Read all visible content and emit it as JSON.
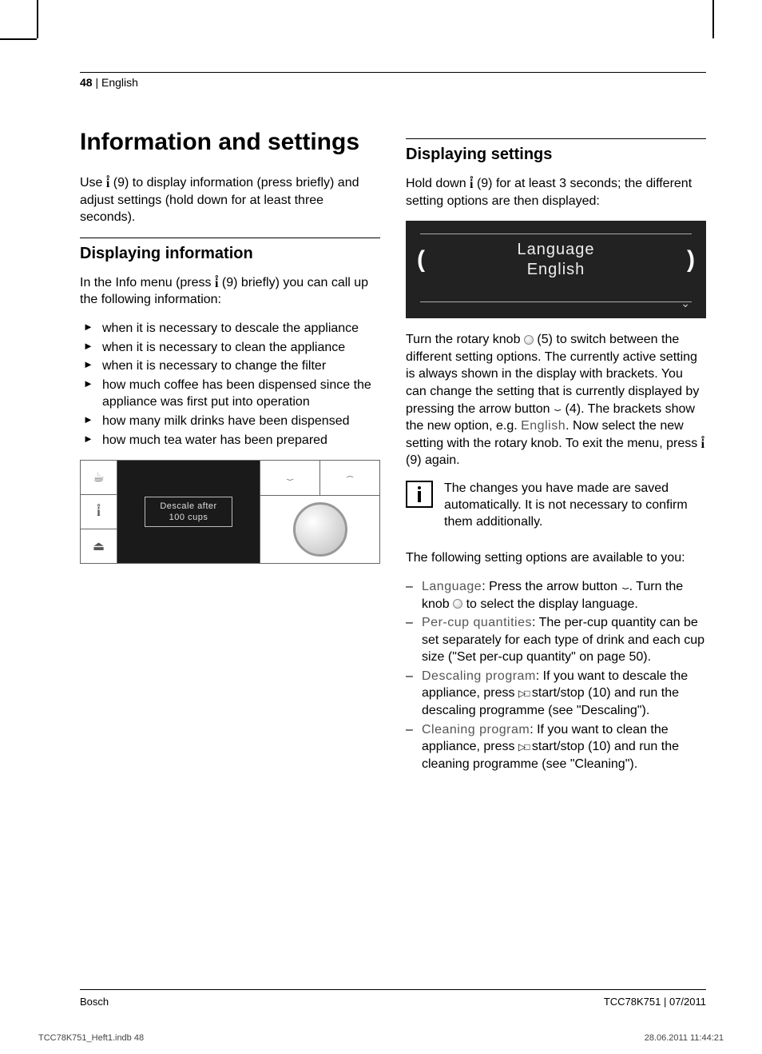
{
  "header": {
    "page_num": "48",
    "lang": "English"
  },
  "col1": {
    "h1": "Information and settings",
    "p1a": "Use ",
    "p1b": " (9) to display information (press briefly) and adjust settings (hold down for at least three seconds).",
    "h2": "Displaying information",
    "p2a": "In the Info menu (press ",
    "p2b": " (9) briefly) you can call up the following information:",
    "bullets": [
      "when it is necessary to descale the appliance",
      "when it is necessary to clean the appliance",
      "when it is necessary to change the filter",
      "how much coffee has been dispensed since the appliance was first put into operation",
      "how many milk drinks have been dispensed",
      "how much tea water has been prepared"
    ],
    "panel": {
      "l1": "Descale after",
      "l2": "100 cups"
    }
  },
  "col2": {
    "h2": "Displaying settings",
    "p1a": "Hold down ",
    "p1b": " (9) for at least 3 seconds; the different setting options are then displayed:",
    "settings_box": {
      "title": "Language",
      "value": "English"
    },
    "p2a": "Turn the rotary knob ",
    "p2b": " (5) to switch between the different setting options. The currently active setting is always shown in the display with brackets. You can change the setting that is currently displayed by pressing the arrow button ",
    "p2c": " (4). The brackets show the new option, e.g. ",
    "p2d": ". Now select the new setting with the rotary knob. To exit the menu, press ",
    "p2e": " (9) again.",
    "p2_english": "English",
    "note": "The changes you have made are saved automatically. It is not necessary to confirm them additionally.",
    "p3": "The following setting options are available to you:",
    "opts": [
      {
        "k": "Language",
        "t": ": Press the arrow button ",
        "t2": ". Turn the knob ",
        "t3": " to select the display language."
      },
      {
        "k": "Per-cup quantities",
        "t": ": The per-cup quantity can be set separately for each type of drink and each cup size (\"Set per-cup quantity\" on page 50)."
      },
      {
        "k": "Descaling program",
        "t": ": If you want to descale the appliance, press ",
        "t2": " start/stop (10) and run the descaling programme (see \"Descaling\")."
      },
      {
        "k": "Cleaning program",
        "t": ": If you want to clean the appliance, press ",
        "t2": " start/stop (10) and run the cleaning programme (see \"Cleaning\")."
      }
    ]
  },
  "footer": {
    "left": "Bosch",
    "right": "TCC78K751 | 07/2011"
  },
  "printfooter": {
    "left": "TCC78K751_Heft1.indb   48",
    "right": "28.06.2011   11:44:21"
  }
}
